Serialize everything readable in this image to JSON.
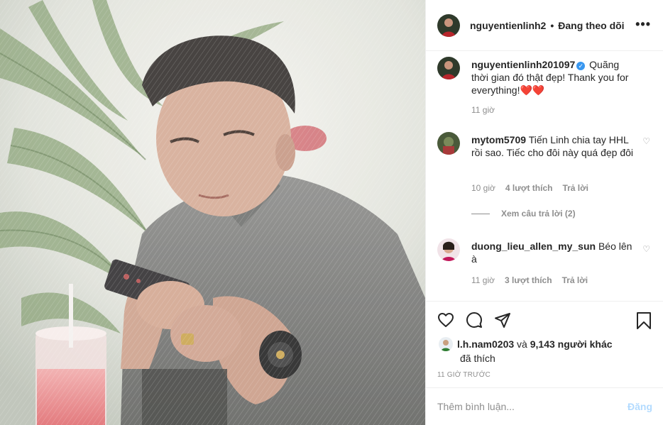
{
  "header": {
    "username": "nguyentienlinh2",
    "separator": "•",
    "follow_status": "Đang theo dõi",
    "more": "•••"
  },
  "caption": {
    "username": "nguyentienlinh201097",
    "text": "Quãng thời gian đó thật đẹp! Thank you for everything!",
    "emoji": "❤️❤️",
    "time": "11 giờ"
  },
  "comments": [
    {
      "username": "mytom5709",
      "text": "Tiến Linh chia tay HHL rồi sao. Tiếc cho đôi này quá đẹp đôi",
      "time": "10 giờ",
      "likes": "4 lượt thích",
      "reply": "Trả lời"
    },
    {
      "username": "duong_lieu_allen_my_sun",
      "text": "Béo lên à",
      "time": "11 giờ",
      "likes": "3 lượt thích",
      "reply": "Trả lời"
    }
  ],
  "view_replies": "Xem câu trả lời (2)",
  "likes_line": {
    "user": "l.h.nam0203",
    "and": "và",
    "others": "9,143 người khác",
    "suffix": "đã thích"
  },
  "time_ago": "11 GIỜ TRƯỚC",
  "add_comment": {
    "placeholder": "Thêm bình luận...",
    "post_label": "Đăng"
  },
  "icons": {
    "like": "heart-icon",
    "comment": "comment-icon",
    "share": "share-icon",
    "save": "bookmark-icon",
    "comment_like": "heart-small-icon",
    "verified": "verified-badge-icon"
  },
  "colors": {
    "text": "#262626",
    "muted": "#8e8e8e",
    "verified": "#3897f0",
    "post_disabled": "#b3dbff",
    "divider": "#efefef"
  }
}
